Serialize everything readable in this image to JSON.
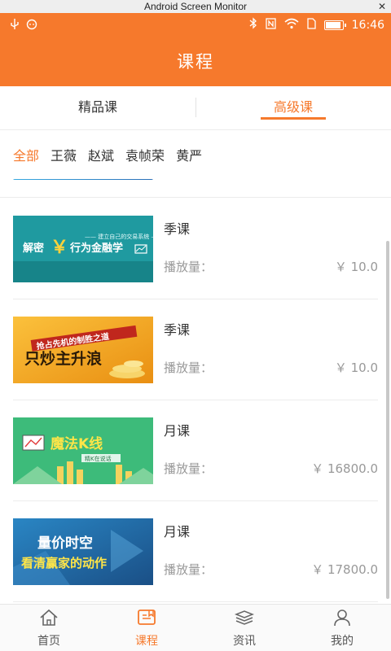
{
  "monitor": {
    "title": "Android Screen Monitor",
    "close_label": "✕"
  },
  "status": {
    "left_icons": [
      "usb-icon",
      "sync-icon"
    ],
    "right_icons": [
      "bluetooth-icon",
      "nfc-icon",
      "wifi-icon",
      "sim-icon"
    ],
    "time": "16:46",
    "battery_level": 0.9
  },
  "header": {
    "title": "课程"
  },
  "tabs": [
    {
      "label": "精品课",
      "active": false
    },
    {
      "label": "高级课",
      "active": true
    }
  ],
  "filters": [
    {
      "label": "全部",
      "active": true
    },
    {
      "label": "王薇",
      "active": false
    },
    {
      "label": "赵斌",
      "active": false
    },
    {
      "label": "袁帧荣",
      "active": false
    },
    {
      "label": "黄严",
      "active": false
    }
  ],
  "courses": [
    {
      "title": "季课",
      "plays_label": "播放量：",
      "price": "￥  10.0",
      "thumb": {
        "main": "解密",
        "symbol": "￥",
        "sub": "行为金融学",
        "top": "—— 建立自己的交易系统 ——",
        "bg": "#1f9aa0"
      }
    },
    {
      "title": "季课",
      "plays_label": "播放量：",
      "price": "￥  10.0",
      "thumb": {
        "top": "抢占先机的制胜之道",
        "main": "只炒主升浪",
        "bg": "#f2a81f"
      }
    },
    {
      "title": "月课",
      "plays_label": "播放量：",
      "price": "￥  16800.0",
      "thumb": {
        "main": "魔法K线",
        "sub": "精K在说话",
        "bg": "#3dbb7a"
      }
    },
    {
      "title": "月课",
      "plays_label": "播放量：",
      "price": "￥  17800.0",
      "thumb": {
        "main": "量价时空",
        "sub": "看清赢家的动作",
        "bg": "#1f6fa8"
      }
    }
  ],
  "nav": [
    {
      "label": "首页",
      "icon": "home-icon",
      "active": false
    },
    {
      "label": "课程",
      "icon": "course-icon",
      "active": true
    },
    {
      "label": "资讯",
      "icon": "news-icon",
      "active": false
    },
    {
      "label": "我的",
      "icon": "profile-icon",
      "active": false
    }
  ],
  "colors": {
    "accent": "#f6792c"
  }
}
